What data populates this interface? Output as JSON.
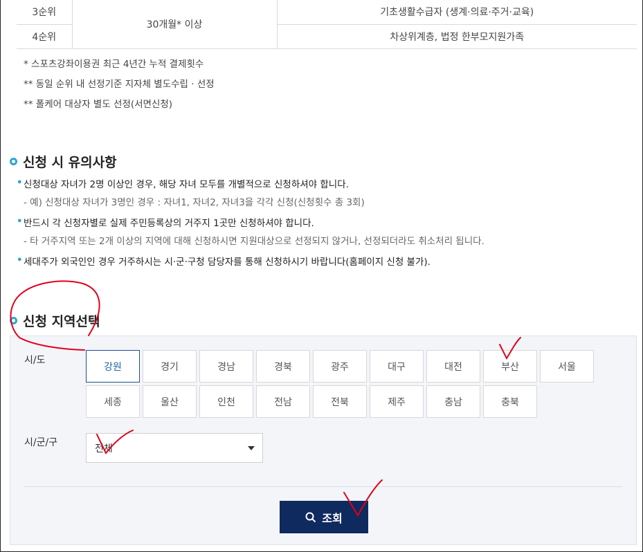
{
  "table": {
    "rows": [
      {
        "rank": "3순위",
        "target": "기초생활수급자 (생계·의료·주거·교육)"
      },
      {
        "rank": "4순위",
        "target": "차상위계층, 법정 한부모지원가족"
      }
    ],
    "period": "30개월* 이상"
  },
  "notes": [
    "* 스포츠강좌이용권 최근 4년간 누적 결제횟수",
    "** 동일 순위 내 선정기준 지자체 별도수립 · 선정",
    "** 폴케어 대상자 별도 선정(서면신청)"
  ],
  "cautions": {
    "title": "신청 시 유의사항",
    "items": [
      {
        "main": "신청대상 자녀가 2명 이상인 경우, 해당 자녀 모두를 개별적으로 신청하셔야 합니다.",
        "sub": "- 예) 신청대상 자녀가 3명인 경우 : 자녀1, 자녀2, 자녀3을 각각 신청(신청횟수 총 3회)"
      },
      {
        "main": "반드시 각 신청자별로 실제 주민등록상의 거주지 1곳만 신청하셔야 합니다.",
        "sub": "- 타 거주지역 또는 2개 이상의 지역에 대해 신청하시면 지원대상으로 선정되지 않거나, 선정되더라도 취소처리 됩니다."
      },
      {
        "main": "세대주가 외국인인 경우 거주하시는 시·군·구청 담당자를 통해 신청하시기 바랍니다(홈페이지 신청 불가).",
        "sub": ""
      }
    ]
  },
  "region": {
    "title": "신청 지역선택",
    "sido_label": "시/도",
    "sigungu_label": "시/군/구",
    "regions": [
      "강원",
      "경기",
      "경남",
      "경북",
      "광주",
      "대구",
      "대전",
      "부산",
      "서울",
      "세종",
      "울산",
      "인천",
      "전남",
      "전북",
      "제주",
      "충남",
      "충북"
    ],
    "selected": "강원",
    "sigungu_value": "전체",
    "search_label": "조회"
  },
  "colors": {
    "accent": "#2aa6cf",
    "navy": "#0f2a5e",
    "annotation": "#e0001a"
  }
}
